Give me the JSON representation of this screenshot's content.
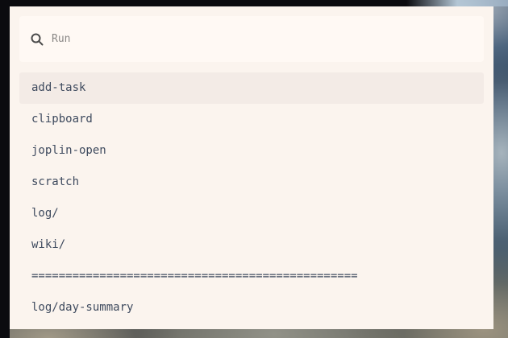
{
  "launcher": {
    "search": {
      "placeholder": "Run",
      "value": ""
    },
    "selected_index": 0,
    "results": [
      {
        "label": "add-task"
      },
      {
        "label": "clipboard"
      },
      {
        "label": "joplin-open"
      },
      {
        "label": "scratch"
      },
      {
        "label": "log/"
      },
      {
        "label": "wiki/"
      },
      {
        "label": "================================================"
      },
      {
        "label": "log/day-summary"
      }
    ]
  },
  "icons": {
    "search": "search-icon"
  },
  "colors": {
    "panel_background": "#fbf4ee",
    "search_background": "#fff9f4",
    "selected_row": "#f3ebe6",
    "item_text": "#3e4a5e",
    "placeholder_text": "#8a8886"
  }
}
